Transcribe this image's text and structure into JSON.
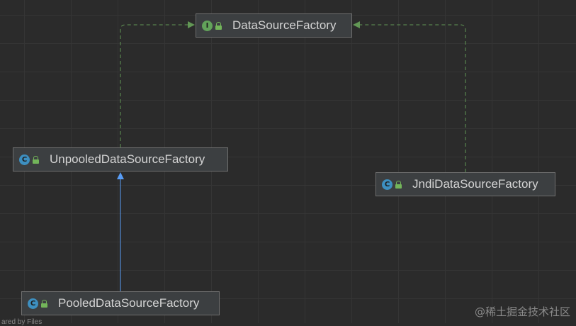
{
  "nodes": {
    "datasource_factory": {
      "name": "DataSourceFactory",
      "kind": "interface",
      "badge": "I"
    },
    "unpooled": {
      "name": "UnpooledDataSourceFactory",
      "kind": "class",
      "badge": "C"
    },
    "jndi": {
      "name": "JndiDataSourceFactory",
      "kind": "class",
      "badge": "C"
    },
    "pooled": {
      "name": "PooledDataSourceFactory",
      "kind": "class",
      "badge": "C"
    }
  },
  "relations": [
    {
      "from": "unpooled",
      "to": "datasource_factory",
      "type": "implements",
      "style": "dashed",
      "color": "#629755"
    },
    {
      "from": "jndi",
      "to": "datasource_factory",
      "type": "implements",
      "style": "dashed",
      "color": "#629755"
    },
    {
      "from": "pooled",
      "to": "unpooled",
      "type": "extends",
      "style": "solid",
      "color": "#589df6"
    }
  ],
  "colors": {
    "background": "#2b2b2b",
    "node_fill": "#3c3f41",
    "node_border": "#6e6e6e",
    "interface_badge": "#62a35a",
    "class_badge": "#3d8fc0",
    "implements_edge": "#629755",
    "extends_edge": "#589df6"
  },
  "icons": {
    "badge": "type-badge-icon",
    "access": "lock-icon"
  },
  "footer_partial": "ared by Files",
  "watermark": "@稀土掘金技术社区"
}
